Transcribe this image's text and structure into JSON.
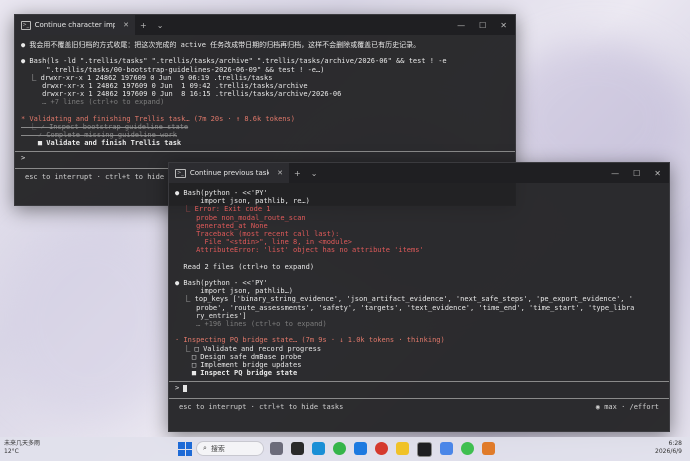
{
  "window1": {
    "tab_title": "Continue character implem",
    "lines": [
      {
        "cls": "white",
        "text": "● 我会用不覆盖旧归档的方式收尾：把这次完成的 active 任务改成带日期的归档再归档，这样不会删除或覆盖已有历史记录。"
      },
      {
        "cls": "white",
        "text": ""
      },
      {
        "cls": "white",
        "text": "● Bash(ls -ld \".trellis/tasks\" \".trellis/tasks/archive\" \".trellis/tasks/archive/2026-06\" && test ! -e"
      },
      {
        "cls": "white",
        "text": "      \".trellis/tasks/00-bootstrap-guidelines-2026-06-09\" && test ! -e…)"
      },
      {
        "cls": "white",
        "text": "  ⎿ drwxr-xr-x 1 24862 197609 0 Jun  9 06:19 .trellis/tasks"
      },
      {
        "cls": "white",
        "text": "     drwxr-xr-x 1 24862 197609 0 Jun  1 09:42 .trellis/tasks/archive"
      },
      {
        "cls": "white",
        "text": "     drwxr-xr-x 1 24862 197609 0 Jun  8 16:15 .trellis/tasks/archive/2026-06"
      },
      {
        "cls": "muted",
        "text": "     … +7 lines (ctrl+o to expand)"
      },
      {
        "cls": "white",
        "text": ""
      },
      {
        "cls": "orange",
        "text": "* Validating and finishing Trellis task… (7m 20s · ↑ 8.6k tokens)"
      },
      {
        "cls": "strike",
        "text": "  ⎿ ✓ Inspect bootstrap guideline state"
      },
      {
        "cls": "strike",
        "text": "    ✓ Complete missing guideline work"
      },
      {
        "cls": "white bold",
        "text": "    ■ Validate and finish Trellis task"
      }
    ],
    "prompt": ">",
    "hint": "esc to interrupt · ctrl+t to hide"
  },
  "window2": {
    "tab_title": "Continue previous task",
    "lines": [
      {
        "cls": "white",
        "text": "● Bash(python - <<'PY'"
      },
      {
        "cls": "white",
        "text": "      import json, pathlib, re…)"
      },
      {
        "cls": "red",
        "text": "  ⎿ Error: Exit code 1"
      },
      {
        "cls": "red",
        "text": "     probe non_modal_route_scan"
      },
      {
        "cls": "red",
        "text": "     generated_at None"
      },
      {
        "cls": "red",
        "text": "     Traceback (most recent call last):"
      },
      {
        "cls": "red",
        "text": "       File \"<stdin>\", line 8, in <module>"
      },
      {
        "cls": "red",
        "text": "     AttributeError: 'list' object has no attribute 'items'"
      },
      {
        "cls": "white",
        "text": ""
      },
      {
        "cls": "white",
        "text": "  Read 2 files (ctrl+o to expand)"
      },
      {
        "cls": "white",
        "text": ""
      },
      {
        "cls": "white",
        "text": "● Bash(python - <<'PY'"
      },
      {
        "cls": "white",
        "text": "      import json, pathlib…)"
      },
      {
        "cls": "white",
        "text": "  ⎿ top_keys ['binary_string_evidence', 'json_artifact_evidence', 'next_safe_steps', 'pe_export_evidence', '"
      },
      {
        "cls": "white",
        "text": "     probe', 'route_assessments', 'safety', 'targets', 'text_evidence', 'time_end', 'time_start', 'type_libra"
      },
      {
        "cls": "white",
        "text": "     ry_entries']"
      },
      {
        "cls": "muted",
        "text": "     … +196 lines (ctrl+o to expand)"
      },
      {
        "cls": "white",
        "text": ""
      },
      {
        "cls": "orange",
        "text": "· Inspecting PQ bridge state… (7m 9s · ↓ 1.0k tokens · thinking)"
      },
      {
        "cls": "white",
        "text": "  ⎿ □ Validate and record progress"
      },
      {
        "cls": "white",
        "text": "    □ Design safe dmBase probe"
      },
      {
        "cls": "white",
        "text": "    □ Implement bridge updates"
      },
      {
        "cls": "white bold",
        "text": "    ■ Inspect PQ bridge state"
      }
    ],
    "prompt": ">",
    "hint": "esc to interrupt · ctrl+t to hide tasks",
    "effort": "◉ max · /effort"
  },
  "taskbar": {
    "weather_line1": "未来几天多雨",
    "weather_line2": "12°C",
    "search_placeholder": "搜索",
    "time": "6:28",
    "date": "2026/6/9"
  }
}
